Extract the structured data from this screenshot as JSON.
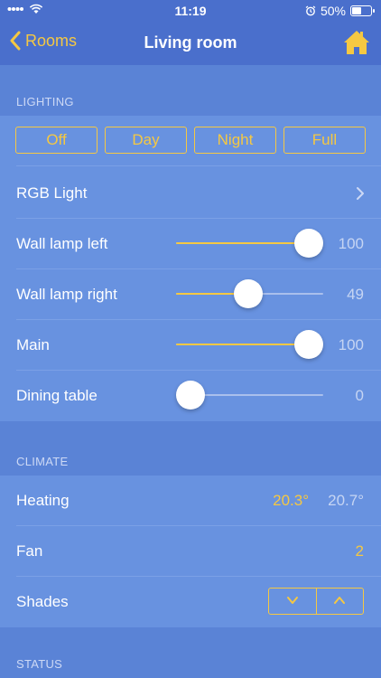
{
  "status_bar": {
    "time": "11:19",
    "battery_percent_label": "50%",
    "battery_level": 0.5
  },
  "nav": {
    "back_label": "Rooms",
    "title": "Living room",
    "home_icon": "home-icon"
  },
  "lighting": {
    "header": "LIGHTING",
    "modes": [
      "Off",
      "Day",
      "Night",
      "Full"
    ],
    "rgb_label": "RGB Light",
    "dimmers": [
      {
        "label": "Wall lamp left",
        "value": "100",
        "level": 100
      },
      {
        "label": "Wall lamp right",
        "value": "49",
        "level": 49
      },
      {
        "label": "Main",
        "value": "100",
        "level": 100
      },
      {
        "label": "Dining table",
        "value": "0",
        "level": 0
      }
    ]
  },
  "climate": {
    "header": "CLIMATE",
    "heating_label": "Heating",
    "heating_set": "20.3°",
    "heating_current": "20.7°",
    "fan_label": "Fan",
    "fan_value": "2",
    "shades_label": "Shades",
    "shades_down": "v",
    "shades_up": "^"
  },
  "status": {
    "header": "STATUS"
  },
  "colors": {
    "accent": "#f5c842",
    "background": "#5a83d6",
    "bar": "#4a6fcc",
    "row": "#6892e0"
  }
}
